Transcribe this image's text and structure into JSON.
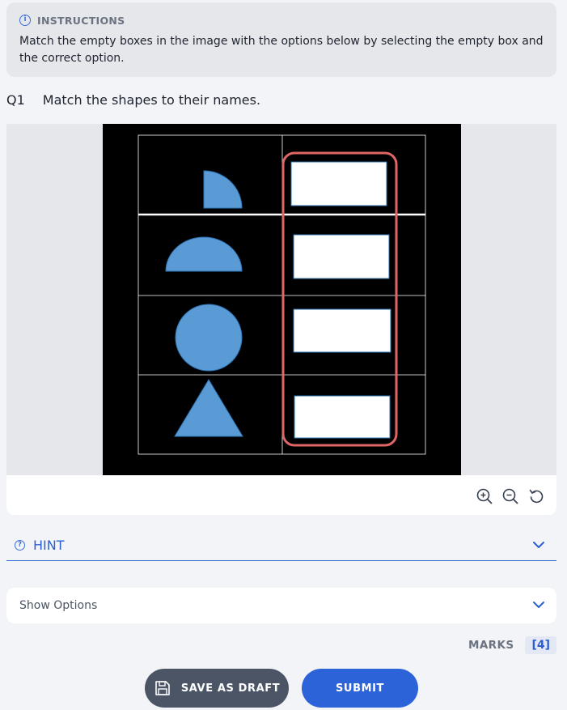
{
  "instructions": {
    "title": "INSTRUCTIONS",
    "icon": "info-icon",
    "text": "Match the empty boxes in the image with the options below by selecting the empty box and the correct option."
  },
  "question": {
    "number": "Q1",
    "text": "Match the shapes to their names."
  },
  "image": {
    "shapes": [
      "quarter circle",
      "semicircle",
      "circle",
      "triangle"
    ],
    "empty_boxes": 4,
    "colors": {
      "shape_fill": "#5b9bd5",
      "highlight": "#e06666",
      "background": "#000000"
    }
  },
  "zoom_tools": [
    "zoom-in-icon",
    "zoom-out-icon",
    "reset-icon"
  ],
  "hint": {
    "label": "HINT",
    "icon": "help-icon"
  },
  "options": {
    "label": "Show Options"
  },
  "marks": {
    "label": "MARKS",
    "value": "[4]"
  },
  "buttons": {
    "save_draft": "SAVE AS DRAFT",
    "submit": "SUBMIT"
  },
  "colors": {
    "accent": "#2d63d8",
    "draft_button": "#4b5566"
  }
}
